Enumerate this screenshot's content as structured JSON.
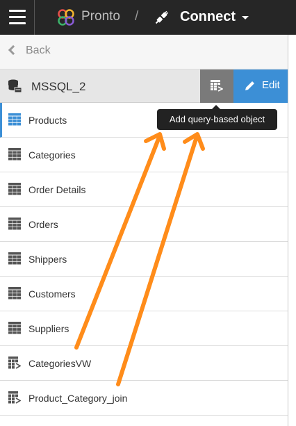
{
  "header": {
    "app_name": "Pronto",
    "separator": "/",
    "section": "Connect"
  },
  "nav": {
    "back_label": "Back"
  },
  "source": {
    "name": "MSSQL_2",
    "edit_label": "Edit",
    "add_query_tooltip": "Add query-based object"
  },
  "objects": [
    {
      "label": "Products",
      "icon": "table-icon",
      "selected": true
    },
    {
      "label": "Categories",
      "icon": "table-icon"
    },
    {
      "label": "Order Details",
      "icon": "table-icon"
    },
    {
      "label": "Orders",
      "icon": "table-icon"
    },
    {
      "label": "Shippers",
      "icon": "table-icon"
    },
    {
      "label": "Customers",
      "icon": "table-icon"
    },
    {
      "label": "Suppliers",
      "icon": "table-icon"
    },
    {
      "label": "CategoriesVW",
      "icon": "query-table-icon"
    },
    {
      "label": "Product_Category_join",
      "icon": "query-table-icon"
    }
  ],
  "colors": {
    "topbar": "#262626",
    "accent": "#3c8fd6",
    "annotation_arrow": "#ff8c1a"
  }
}
